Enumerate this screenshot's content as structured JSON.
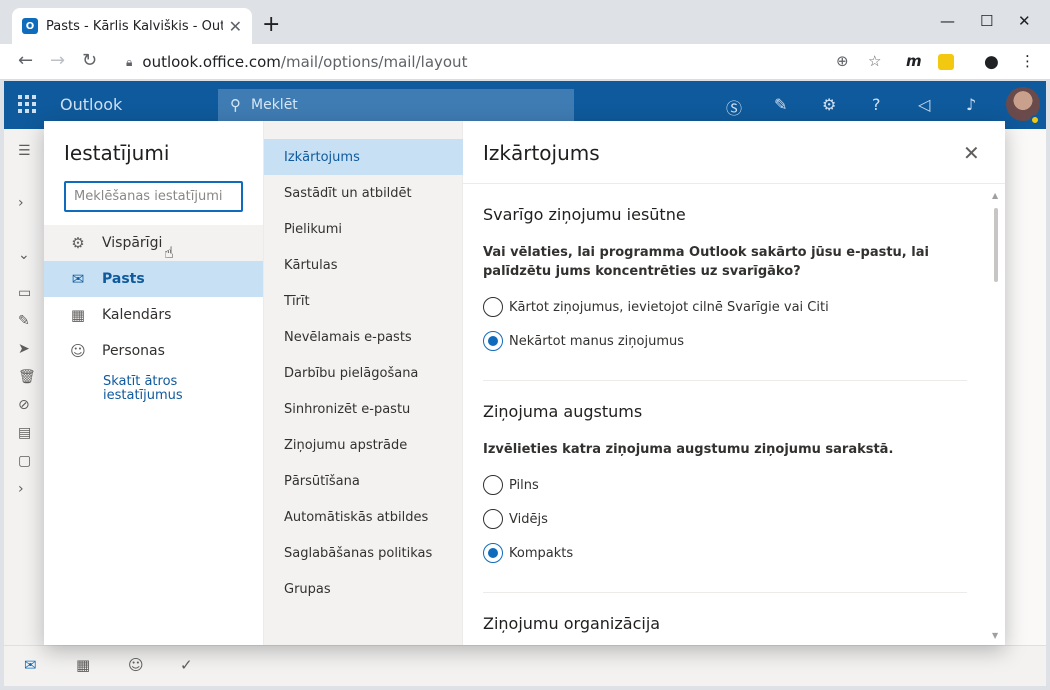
{
  "browser": {
    "tab_title": "Pasts - Kārlis Kalviškis - Outlook",
    "tab_favicon": "O",
    "new_tab": "+",
    "url_host": "outlook.office.com",
    "url_path": "/mail/options/mail/layout",
    "profile_badge": "m"
  },
  "app": {
    "name": "Outlook",
    "search_placeholder": "Meklēt"
  },
  "settings": {
    "title": "Iestatījumi",
    "search_placeholder": "Meklēšanas iestatījumi",
    "categories": [
      {
        "label": "Vispārīgi",
        "icon": "gear-icon"
      },
      {
        "label": "Pasts",
        "icon": "mail-icon"
      },
      {
        "label": "Kalendārs",
        "icon": "calendar-icon"
      },
      {
        "label": "Personas",
        "icon": "people-icon"
      }
    ],
    "quick_link": "Skatīt ātros iestatījumus",
    "subcategories": [
      "Izkārtojums",
      "Sastādīt un atbildēt",
      "Pielikumi",
      "Kārtulas",
      "Tīrīt",
      "Nevēlamais e-pasts",
      "Darbību pielāgošana",
      "Sinhronizēt e-pastu",
      "Ziņojumu apstrāde",
      "Pārsūtīšana",
      "Automātiskās atbildes",
      "Saglabāšanas politikas",
      "Grupas"
    ]
  },
  "pane": {
    "title": "Izkārtojums",
    "focused": {
      "title": "Svarīgo ziņojumu iesūtne",
      "question": "Vai vēlaties, lai programma Outlook sakārto jūsu e-pastu, lai palīdzētu jums koncentrēties uz svarīgāko?",
      "option1": "Kārtot ziņojumus, ievietojot cilnē Svarīgie vai Citi",
      "option2": "Nekārtot manus ziņojumus",
      "selected": 2
    },
    "height": {
      "title": "Ziņojuma augstums",
      "question": "Izvēlieties katra ziņojuma augstumu ziņojumu sarakstā.",
      "option1": "Pilns",
      "option2": "Vidējs",
      "option3": "Kompakts",
      "selected": 3
    },
    "organization": {
      "title": "Ziņojumu organizācija"
    }
  },
  "colors": {
    "header": "#0f5a9c",
    "accent": "#0f6cbd",
    "selected_bg": "#c7e0f4"
  }
}
